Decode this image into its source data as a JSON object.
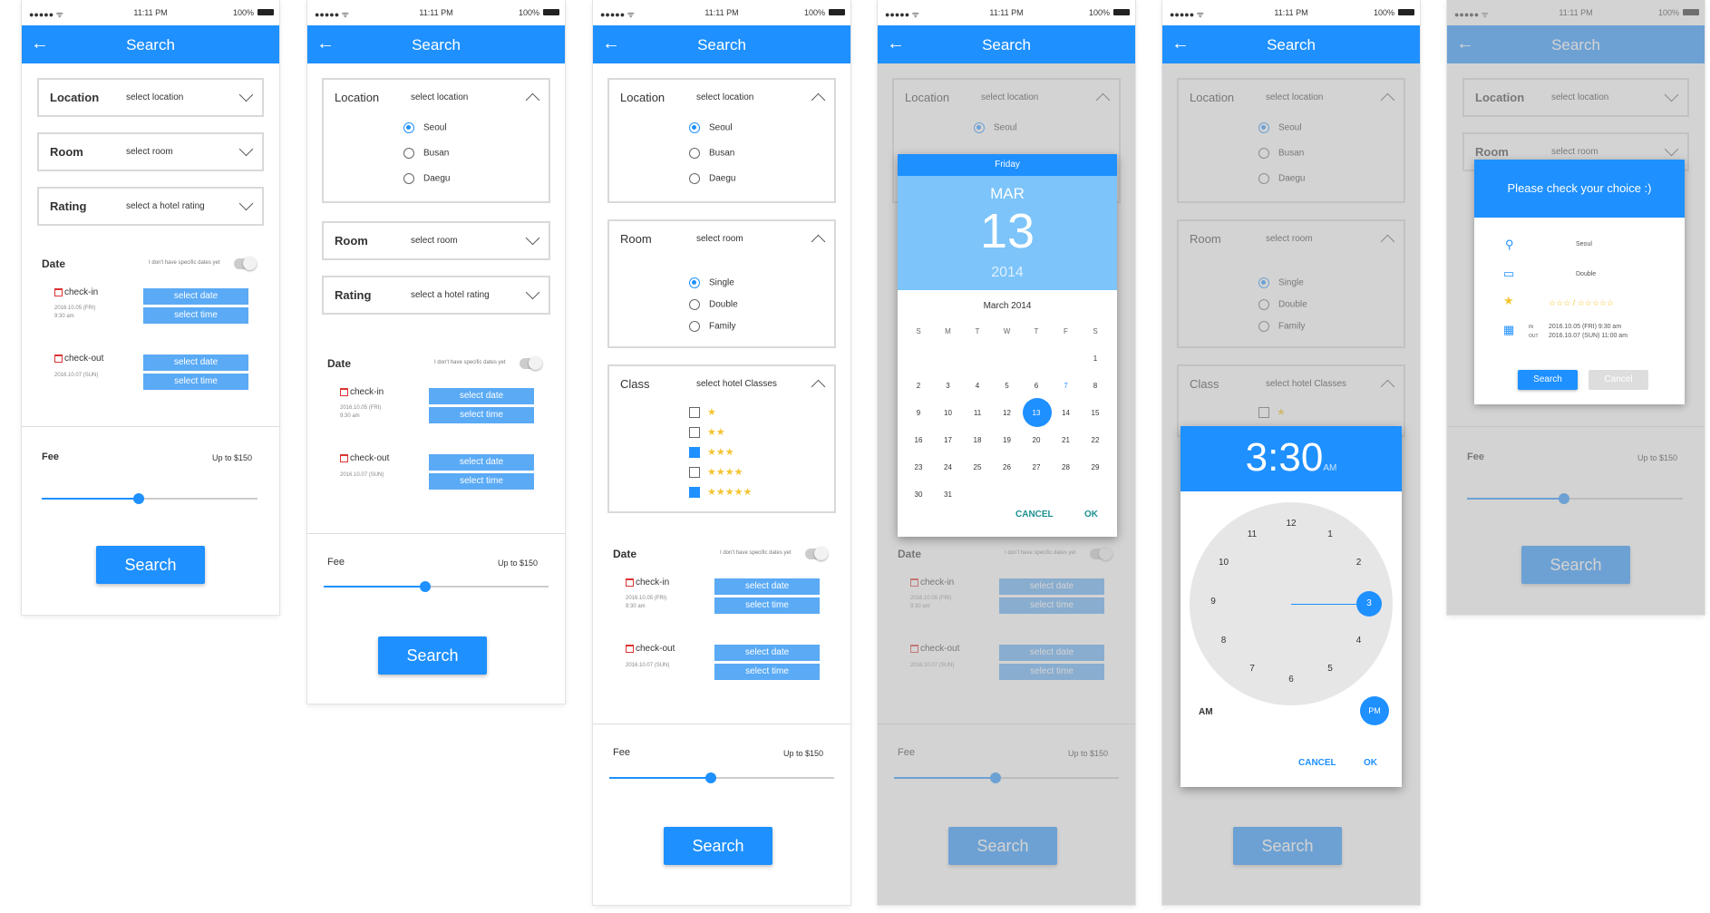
{
  "status": {
    "signal": "●●●●● ᯤ",
    "time": "11:11 PM",
    "battery": "100%"
  },
  "appbar": {
    "title": "Search",
    "back_icon": "←"
  },
  "location": {
    "label": "Location",
    "placeholder": "select location",
    "options": [
      "Seoul",
      "Busan",
      "Daegu"
    ]
  },
  "room": {
    "label": "Room",
    "placeholder": "select room",
    "options": [
      "Single",
      "Double",
      "Family"
    ]
  },
  "rating": {
    "label": "Rating",
    "placeholder": "select a hotel rating"
  },
  "hotel_class": {
    "label": "Class",
    "placeholder": "select hotel Classes",
    "options": [
      "★",
      "★★",
      "★★★",
      "★★★★",
      "★★★★★"
    ]
  },
  "date": {
    "title": "Date",
    "toggle_label": "I don't have specific dates yet",
    "checkin_label": "check-in",
    "checkin_sub": "2016.10.05 (FRI)\n9:30 am",
    "checkout_label": "check-out",
    "checkout_sub": "2016.10.07 (SUN)",
    "select_date": "select date",
    "select_time": "select time"
  },
  "fee": {
    "label": "Fee",
    "value": "Up to $150",
    "level": 0.45
  },
  "search_button": "Search",
  "date_picker": {
    "weekday": "Friday",
    "month": "MAR",
    "day": "13",
    "year": "2014",
    "month_title": "March 2014",
    "weekdays": [
      "S",
      "M",
      "T",
      "W",
      "T",
      "F",
      "S"
    ],
    "weeks": [
      [
        "",
        "",
        "",
        "",
        "",
        "",
        "1"
      ],
      [
        "2",
        "3",
        "4",
        "5",
        "6",
        "7",
        "8"
      ],
      [
        "9",
        "10",
        "11",
        "12",
        "13",
        "14",
        "15"
      ],
      [
        "16",
        "17",
        "18",
        "19",
        "20",
        "21",
        "22"
      ],
      [
        "23",
        "24",
        "25",
        "26",
        "27",
        "28",
        "29"
      ],
      [
        "30",
        "31",
        "",
        "",
        "",
        "",
        ""
      ]
    ],
    "selected": "13",
    "today": "7",
    "cancel": "CANCEL",
    "ok": "OK"
  },
  "time_picker": {
    "hour": "3",
    "colon": ":",
    "minute": "30",
    "ampm": "AM",
    "numbers": [
      "12",
      "1",
      "2",
      "3",
      "4",
      "5",
      "6",
      "7",
      "8",
      "9",
      "10",
      "11"
    ],
    "am_label": "AM",
    "pm_label": "PM",
    "cancel": "CANCEL",
    "ok": "OK"
  },
  "confirm": {
    "title": "Please check your choice :)",
    "location": "Seoul",
    "room": "Double",
    "rating": "☆☆☆ / ☆☆☆☆☆",
    "in_tag": "IN",
    "out_tag": "OUT",
    "checkin": "2016.10.05 (FRI) 9:30 am",
    "checkout": "2016.10.07 (SUN) 11:00 am",
    "search": "Search",
    "cancel": "Cancel"
  },
  "colors": {
    "accent": "#1e90ff",
    "button": "#5aaaf5",
    "star": "#f4c430"
  }
}
